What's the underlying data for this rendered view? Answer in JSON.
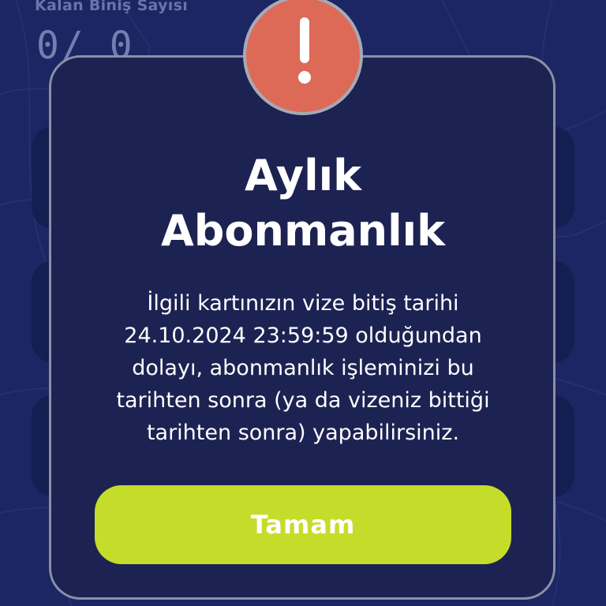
{
  "background": {
    "remaining_rides_label": "Kalan Biniş Sayısı",
    "remaining_rides_value": "0/ 0"
  },
  "dialog": {
    "icon": "exclamation-icon",
    "title_line1": "Aylık",
    "title_line2": "Abonmanlık",
    "message": "İlgili kartınızın vize bitiş tarihi\n24.10.2024 23:59:59  olduğundan\ndolayı, abonmanlık işleminizi bu\ntarihten sonra (ya da vizeniz bittiği\ntarihten sonra) yapabilirsiniz.",
    "confirm_label": "Tamam"
  },
  "colors": {
    "background": "#1f2b70",
    "dialog_background": "#1c2352",
    "alert": "#dd6a57",
    "button": "#c6dc2a",
    "text": "#ffffff"
  }
}
